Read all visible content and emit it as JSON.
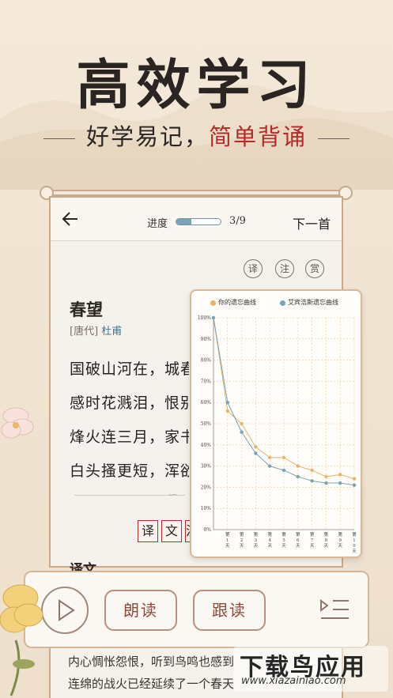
{
  "hero": {
    "title": "高效学习",
    "subtitle_part1": "好学易记，",
    "subtitle_part2": "简单背诵",
    "accent_color": "#b52a2a"
  },
  "header": {
    "progress_label": "进度",
    "progress_value": 0.333,
    "progress_count": "3/9",
    "next_label": "下一首"
  },
  "tools": [
    "译",
    "注",
    "赏"
  ],
  "poem": {
    "title": "春望",
    "dynasty": "[唐代]",
    "author": "杜甫",
    "lines": [
      "国破山河在，城春草木深。",
      "感时花溅泪，恨别鸟惊心。",
      "烽火连三月，家书抵万金。",
      "白头搔更短，浑欲不胜簪。"
    ]
  },
  "mode_chips": [
    "译",
    "文",
    "注"
  ],
  "section": {
    "label": "译文"
  },
  "translation_lines": [
    "内心惆怅怨恨，听到鸟鸣也感到",
    "连绵的战火已经延续了一个春天"
  ],
  "controls": {
    "read_label": "朗读",
    "follow_label": "跟读"
  },
  "chart_data": {
    "type": "line",
    "legend": [
      {
        "name": "你的遗忘曲线",
        "color": "#e5b46a"
      },
      {
        "name": "艾宾浩斯遗忘曲线",
        "color": "#7aa3b3"
      }
    ],
    "x_labels": [
      "第1天",
      "第2天",
      "第3天",
      "第4天",
      "第5天",
      "第6天",
      "第7天",
      "第8天",
      "第9天",
      "第10天"
    ],
    "y_ticks": [
      "100%",
      "90%",
      "80%",
      "70%",
      "60%",
      "50%",
      "40%",
      "30%",
      "20%",
      "10%",
      "0%"
    ],
    "ylim": [
      0,
      100
    ],
    "series": [
      {
        "name": "你的遗忘曲线",
        "values": [
          100,
          56,
          50,
          39,
          34,
          34,
          30,
          28,
          25,
          26,
          24
        ]
      },
      {
        "name": "艾宾浩斯遗忘曲线",
        "values": [
          100,
          60,
          46,
          36,
          30,
          28,
          25,
          23,
          22,
          22,
          21
        ]
      }
    ]
  },
  "watermark": {
    "main": "下载鸟应用",
    "url": "www.xiazainiao.com"
  }
}
